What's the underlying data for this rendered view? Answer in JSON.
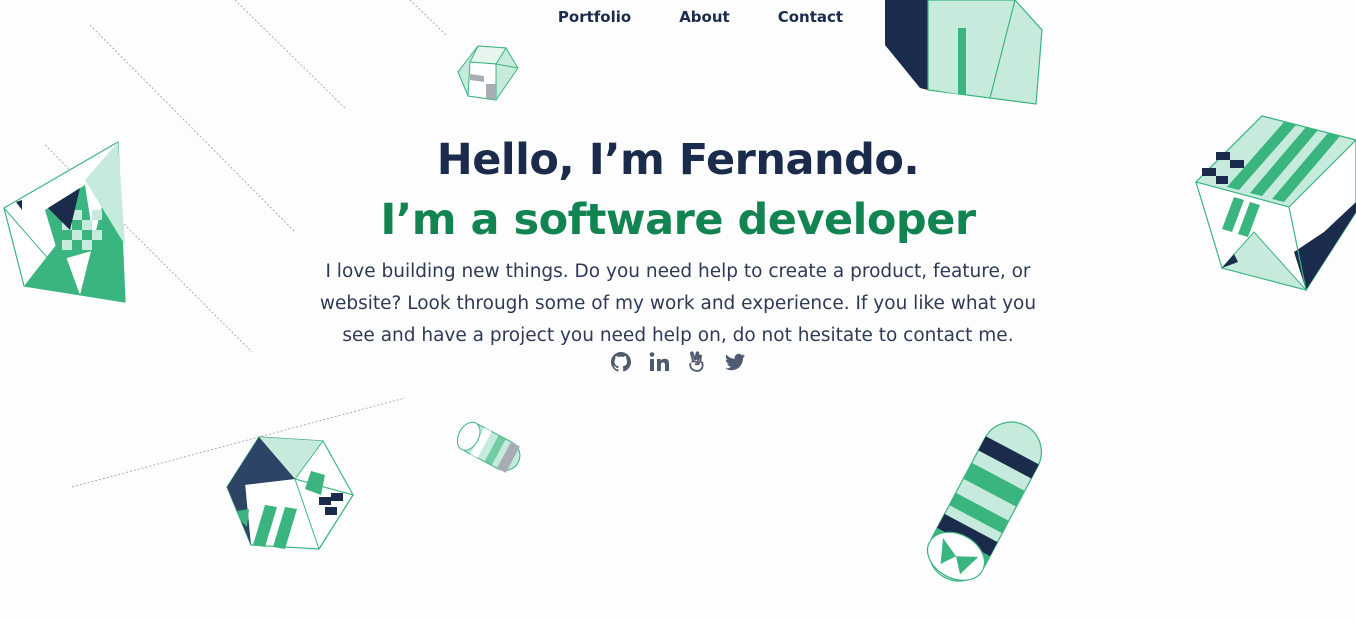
{
  "nav": {
    "items": [
      {
        "label": "Portfolio"
      },
      {
        "label": "About"
      },
      {
        "label": "Contact"
      }
    ]
  },
  "hero": {
    "greeting": "Hello, I’m Fernando.",
    "role": "I’m a software developer",
    "intro": "I love building new things. Do you need help to create a product, feature, or website? Look through some of my work and experience. If you like what you see and have a project you need help on, do not hesitate to contact me."
  },
  "socials": [
    {
      "icon": "github-icon"
    },
    {
      "icon": "linkedin-icon"
    },
    {
      "icon": "angellist-icon"
    },
    {
      "icon": "twitter-icon"
    }
  ],
  "colors": {
    "navy": "#1a2b4c",
    "green": "#118452",
    "mint": "#c6eadb",
    "accent_green": "#3bb57f",
    "text": "#2c3a55",
    "icon": "#4e5a70"
  }
}
